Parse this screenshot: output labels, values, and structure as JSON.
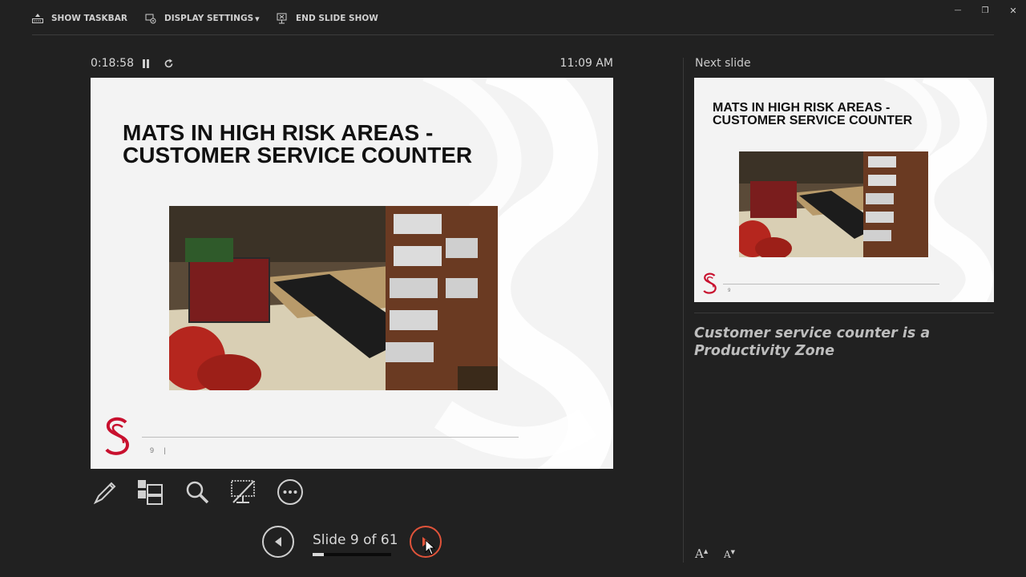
{
  "toolbar": {
    "show_taskbar": "SHOW TASKBAR",
    "display_settings": "DISPLAY SETTINGS",
    "display_settings_caret": "▾",
    "end_slide_show": "END SLIDE SHOW"
  },
  "window_controls": {
    "minimize": "—",
    "restore": "❐",
    "close": "✕"
  },
  "timer": {
    "elapsed": "0:18:58"
  },
  "clock": "11:09 AM",
  "current_slide": {
    "title_line1": "MATS IN HIGH RISK AREAS -",
    "title_line2": "CUSTOMER SERVICE COUNTER",
    "page_number": "9",
    "page_separator": "|"
  },
  "next_slide": {
    "label": "Next slide",
    "title_line1": "MATS IN HIGH RISK AREAS -",
    "title_line2": "CUSTOMER SERVICE COUNTER",
    "page_number": "9"
  },
  "notes": "Customer service counter is a Productivity Zone",
  "navigation": {
    "counter": "Slide 9 of 61",
    "current": 9,
    "total": 61
  },
  "font_controls": {
    "increase": "A",
    "decrease": "A"
  },
  "colors": {
    "background": "#212121",
    "accent_next": "#e0533a",
    "logo_red": "#c8102e"
  }
}
